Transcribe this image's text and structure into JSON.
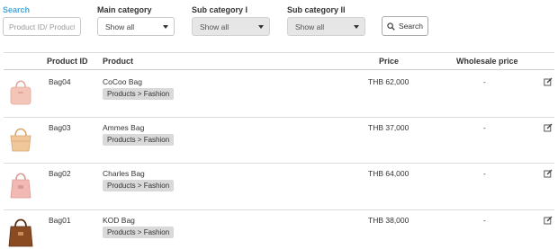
{
  "filters": {
    "search_label": "Search",
    "search_placeholder": "Product ID/ Product",
    "main_category_label": "Main category",
    "main_category_value": "Show all",
    "sub_category1_label": "Sub category I",
    "sub_category1_value": "Show all",
    "sub_category2_label": "Sub category II",
    "sub_category2_value": "Show all",
    "search_button_label": "Search"
  },
  "table": {
    "headers": {
      "product_id": "Product ID",
      "product": "Product",
      "price": "Price",
      "wholesale_price": "Wholesale price"
    },
    "rows": [
      {
        "id": "Bag04",
        "name": "CoCoo Bag",
        "category": "Products > Fashion",
        "price": "THB 62,000",
        "wholesale": "-",
        "thumb_color": "#f3c4b8"
      },
      {
        "id": "Bag03",
        "name": "Ammes Bag",
        "category": "Products > Fashion",
        "price": "THB 37,000",
        "wholesale": "-",
        "thumb_color": "#f0c79a"
      },
      {
        "id": "Bag02",
        "name": "Charles Bag",
        "category": "Products > Fashion",
        "price": "THB 64,000",
        "wholesale": "-",
        "thumb_color": "#f2b9b4"
      },
      {
        "id": "Bag01",
        "name": "KOD Bag",
        "category": "Products > Fashion",
        "price": "THB 38,000",
        "wholesale": "-",
        "thumb_color": "#8a4a22"
      }
    ]
  }
}
